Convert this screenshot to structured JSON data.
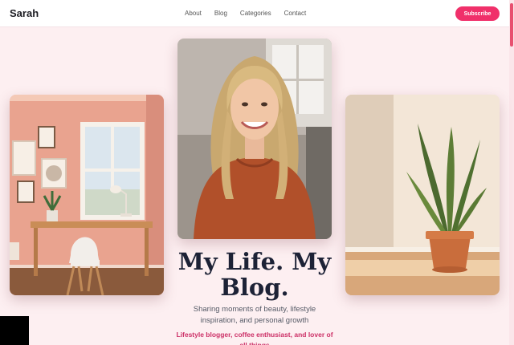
{
  "nav": {
    "brand": "Sarah",
    "links": [
      "About",
      "Blog",
      "Categories",
      "Contact"
    ],
    "subscribe_label": "Subscribe"
  },
  "hero": {
    "title": "My Life. My Blog.",
    "subtitle": "Sharing moments of beauty, lifestyle inspiration, and personal growth",
    "tagline": "Lifestyle blogger, coffee enthusiast, and lover of all things"
  },
  "images": {
    "left": "room-with-desk-image",
    "center": "portrait-photo",
    "right": "potted-plant-image"
  },
  "colors": {
    "accent": "#f0306a",
    "background": "#fdeff1",
    "title": "#1d2236"
  }
}
